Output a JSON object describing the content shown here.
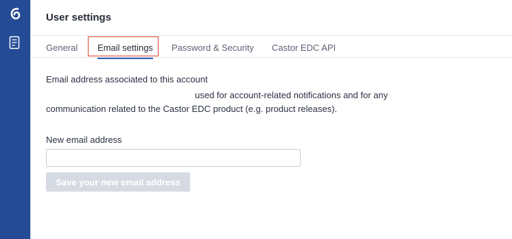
{
  "header": {
    "title": "User settings"
  },
  "tabs": [
    {
      "label": "General",
      "active": false
    },
    {
      "label": "Email settings",
      "active": true
    },
    {
      "label": "Password & Security",
      "active": false
    },
    {
      "label": "Castor EDC API",
      "active": false
    }
  ],
  "nav": {
    "icons": [
      "castor-logo-icon",
      "document-icon"
    ],
    "color": "#244b95"
  },
  "content": {
    "section_label": "Email address associated to this account",
    "description_line1": "used for account-related notifications and for any",
    "description_line2": "communication related to the Castor EDC product (e.g. product releases).",
    "new_email_label": "New email address",
    "new_email_value": "",
    "save_button_label": "Save your new email address"
  },
  "colors": {
    "accent": "#2f5db3",
    "highlight": "#e0452f",
    "disabled_button": "#d6dbe3"
  }
}
